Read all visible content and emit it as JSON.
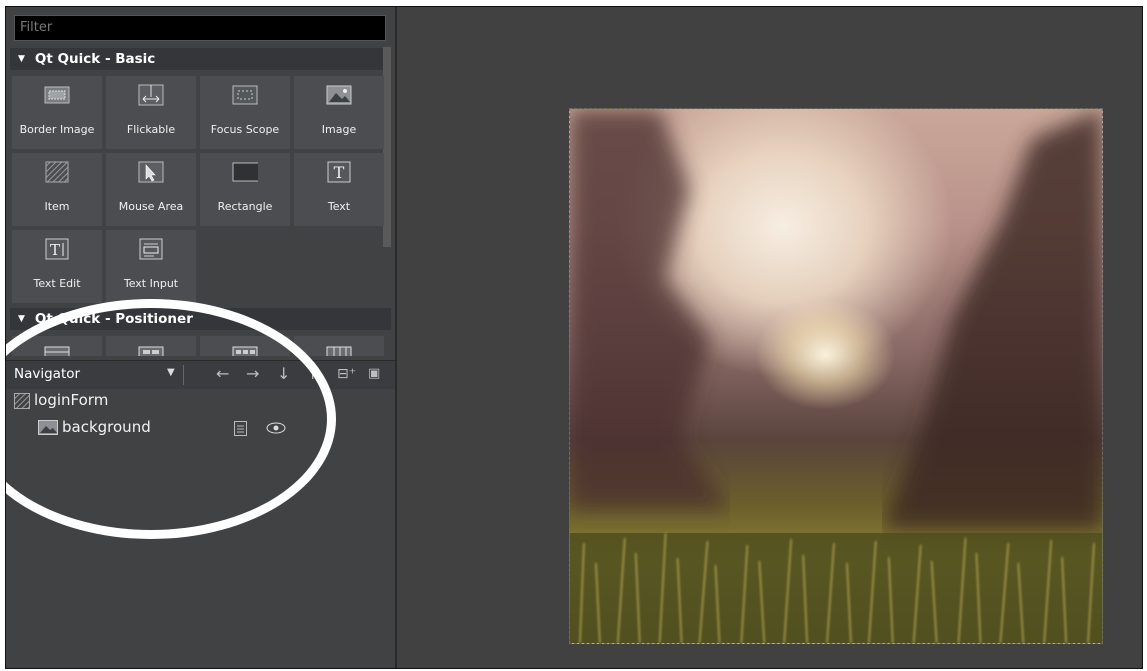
{
  "library": {
    "filter_placeholder": "Filter",
    "categories": [
      {
        "name": "Qt Quick - Basic"
      },
      {
        "name": "Qt Quick - Positioner"
      }
    ],
    "items": [
      {
        "label": "Border Image",
        "icon": "border-image-icon"
      },
      {
        "label": "Flickable",
        "icon": "flickable-icon"
      },
      {
        "label": "Focus Scope",
        "icon": "focus-scope-icon"
      },
      {
        "label": "Image",
        "icon": "image-icon"
      },
      {
        "label": "Item",
        "icon": "item-icon"
      },
      {
        "label": "Mouse Area",
        "icon": "mouse-area-icon"
      },
      {
        "label": "Rectangle",
        "icon": "rectangle-icon"
      },
      {
        "label": "Text",
        "icon": "text-icon"
      },
      {
        "label": "Text Edit",
        "icon": "text-edit-icon"
      },
      {
        "label": "Text Input",
        "icon": "text-input-icon"
      }
    ]
  },
  "navigator": {
    "title": "Navigator",
    "tree": [
      {
        "label": "loginForm",
        "icon": "item-icon"
      },
      {
        "label": "background",
        "icon": "image-icon"
      }
    ]
  },
  "colors": {
    "panel": "#404244",
    "cell": "#4b4d50",
    "canvas": "#414141",
    "highlight_ellipse": "#ffffff"
  }
}
